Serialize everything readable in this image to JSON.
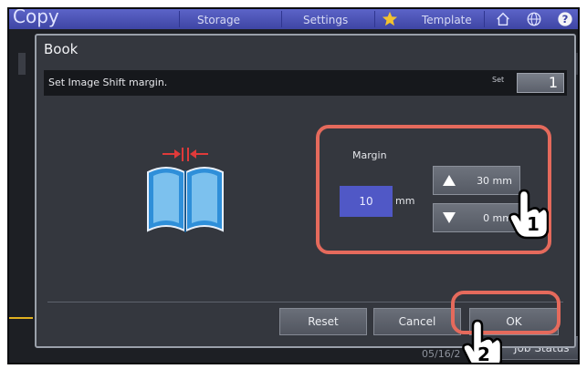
{
  "topbar": {
    "app_title": "Copy",
    "items": [
      "Storage",
      "Settings",
      "Template"
    ],
    "icons": [
      "star-icon",
      "home-icon",
      "globe-icon",
      "help-icon"
    ]
  },
  "dialog": {
    "title": "Book",
    "message": "Set Image Shift margin.",
    "set_label": "Set",
    "set_value": "1"
  },
  "margin": {
    "label": "Margin",
    "value": "10",
    "unit": "mm",
    "up_value": "30 mm",
    "down_value": "0 mm"
  },
  "actions": {
    "reset": "Reset",
    "cancel": "Cancel",
    "ok": "OK"
  },
  "background": {
    "job_status": "Job Status"
  },
  "callouts": [
    "1",
    "2"
  ],
  "colors": {
    "accent": "#5058c6",
    "highlight": "#e56a5c",
    "book_blue": "#2f8fd9"
  }
}
